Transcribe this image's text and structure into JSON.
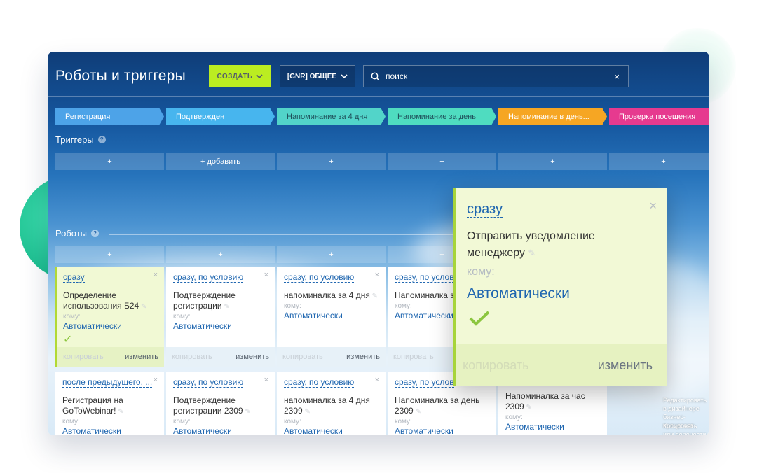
{
  "app": {
    "title": "Роботы и триггеры"
  },
  "toolbar": {
    "create_label": "СОЗДАТЬ",
    "pipeline_label": "[GNR] ОБЩЕЕ",
    "search_placeholder": "поиск",
    "clear_icon": "×"
  },
  "stages": [
    {
      "label": "Регистрация",
      "color": "#4da3e8",
      "text_color": "#ffffff"
    },
    {
      "label": "Подтвержден",
      "color": "#47b5ee",
      "text_color": "#ffffff"
    },
    {
      "label": "Напоминание за 4 дня",
      "color": "#52d4c9",
      "text_color": "#1f4f5a"
    },
    {
      "label": "Напоминание за день",
      "color": "#4fdcc0",
      "text_color": "#1f4f5a"
    },
    {
      "label": "Напоминание в день...",
      "color": "#f6a623",
      "text_color": "#ffffff"
    },
    {
      "label": "Проверка посещения",
      "color": "#e63a8f",
      "text_color": "#ffffff"
    }
  ],
  "triggers": {
    "label": "Триггеры",
    "help": "?",
    "add_cells": [
      "+",
      "+ добавить",
      "+",
      "+",
      "+",
      "+"
    ]
  },
  "robots": {
    "label": "Роботы",
    "help": "?",
    "add_cells": [
      "+",
      "+",
      "+",
      "+"
    ]
  },
  "cards_row1": [
    {
      "when": "сразу",
      "name": "Определение использования Б24",
      "to": "кому:",
      "who": "Автоматически",
      "check": "✓",
      "copy": "копировать",
      "edit": "изменить",
      "close": "×"
    },
    {
      "when": "сразу, по условию",
      "name": "Подтверждение регистрации",
      "to": "кому:",
      "who": "Автоматически",
      "copy": "копировать",
      "edit": "изменить",
      "close": "×"
    },
    {
      "when": "сразу, по условию",
      "name": "напоминалка за 4 дня",
      "to": "кому:",
      "who": "Автоматически",
      "copy": "копировать",
      "edit": "изменить",
      "close": "×"
    },
    {
      "when": "сразу, по услов",
      "name": "Напоминалка з",
      "to": "кому:",
      "who": "Автоматически",
      "copy": "копировать",
      "edit": "",
      "close": ""
    },
    {
      "who": "ки",
      "edit": "изменить",
      "close": "×"
    }
  ],
  "cards_row2": [
    {
      "when": "после предыдущего, ...",
      "name": "Регистрация на GoToWebinar!",
      "to": "кому:",
      "who": "Автоматически",
      "close": "×"
    },
    {
      "when": "сразу, по условию",
      "name": "Подтверждение регистрации 2309",
      "to": "кому:",
      "who": "Автоматически",
      "close": "×"
    },
    {
      "when": "сразу, по условию",
      "name": "напоминалка за 4 дня 2309",
      "to": "кому:",
      "who": "Автоматически",
      "close": "×"
    },
    {
      "when": "сразу, по услов",
      "name": "Напоминалка за день 2309",
      "to": "кому:",
      "who": "Автоматически",
      "close": ""
    },
    {
      "when": "",
      "name": "Напоминалка за час 2309",
      "to": "кому:",
      "who": "Автоматически",
      "close": ""
    }
  ],
  "hints": [
    "Редактировать в дизайнере бизнес-процессов",
    "Копировать или перенести роботов"
  ],
  "popup": {
    "when": "сразу",
    "name": "Отправить уведомление менеджеру",
    "to": "кому:",
    "who": "Автоматически",
    "copy": "копировать",
    "edit": "изменить",
    "close": "×"
  }
}
